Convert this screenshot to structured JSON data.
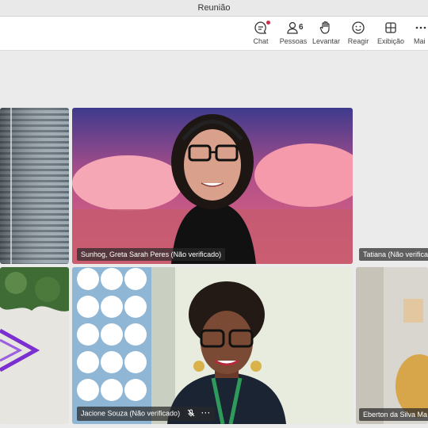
{
  "window": {
    "title": "Reunião"
  },
  "toolbar": {
    "chat_label": "Chat",
    "people_label": "Pessoas",
    "people_count": "6",
    "raise_label": "Levantar",
    "react_label": "Reagir",
    "view_label": "Exibição",
    "more_label": "Mai"
  },
  "participants": [
    {
      "name": "Sunhog, Greta Sarah Peres (Não verificado)"
    },
    {
      "name": "Tatiana (Não verifica"
    },
    {
      "name": "Jacione Souza (Não verificado)"
    },
    {
      "name": "Eberton da Silva Ma"
    }
  ],
  "colors": {
    "notification": "#c4314b",
    "accent": "#7b2fd0"
  }
}
